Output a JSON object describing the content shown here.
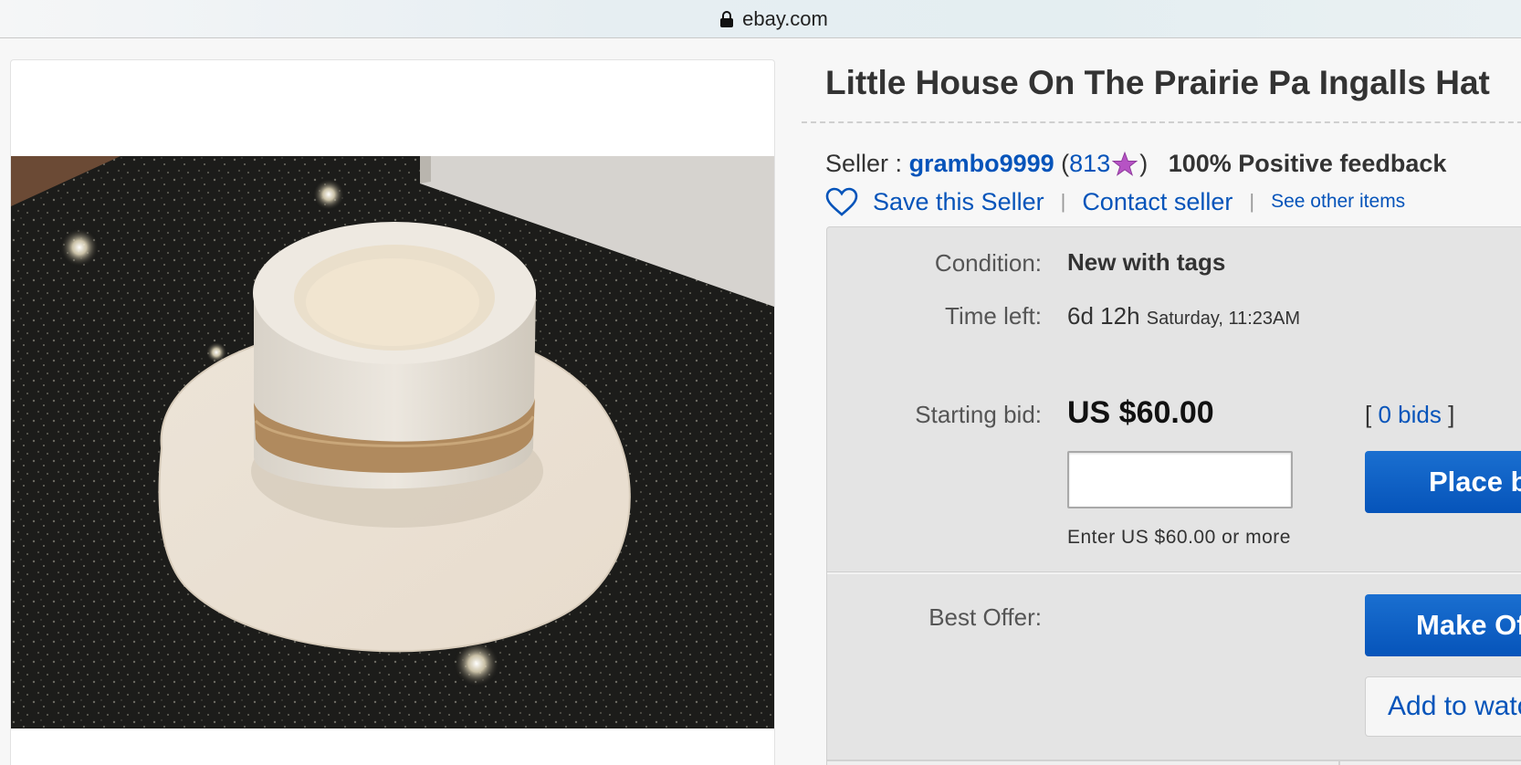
{
  "browser": {
    "url": "ebay.com"
  },
  "listing": {
    "title": "Little House On The Prairie Pa Ingalls Hat",
    "image_alt": "white felt hat on granite countertop"
  },
  "seller": {
    "label": "Seller :",
    "name": "grambo9999",
    "open_paren": "(",
    "feedback_score": "813",
    "close_paren": ")",
    "positive_feedback": "100% Positive feedback",
    "save_label": "Save this Seller",
    "contact_label": "Contact seller",
    "other_items_label": "See other items",
    "separator": "|",
    "star_color": "#b653c4"
  },
  "details": {
    "condition_label": "Condition:",
    "condition_value": "New with tags",
    "time_left_label": "Time left:",
    "time_left_value": "6d 12h",
    "time_left_end": "Saturday, 11:23AM",
    "starting_bid_label": "Starting bid:",
    "starting_bid_value": "US $60.00",
    "bids_open": "[",
    "bids_count": "0 bids",
    "bids_close": "]",
    "bid_input_value": "",
    "bid_hint": "Enter US $60.00 or more",
    "place_bid_label": "Place bid",
    "best_offer_label": "Best Offer:",
    "make_offer_label": "Make Offer",
    "watch_label": "Add to watchlist"
  },
  "colors": {
    "link": "#0654ba",
    "button": "#0654ba",
    "panel": "#e4e4e4"
  }
}
